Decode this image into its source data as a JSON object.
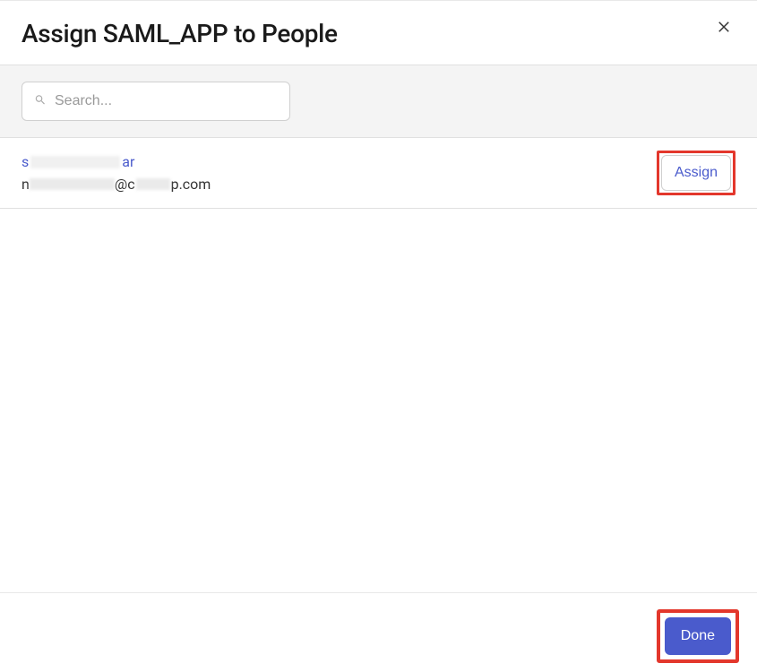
{
  "header": {
    "title": "Assign SAML_APP to People"
  },
  "search": {
    "placeholder": "Search...",
    "value": ""
  },
  "users": [
    {
      "name_prefix": "s",
      "name_suffix": "ar",
      "email_prefix": "n",
      "email_at": "@",
      "email_domain_prefix": "c",
      "email_domain_suffix": "p.com",
      "assign_label": "Assign"
    }
  ],
  "footer": {
    "done_label": "Done"
  }
}
